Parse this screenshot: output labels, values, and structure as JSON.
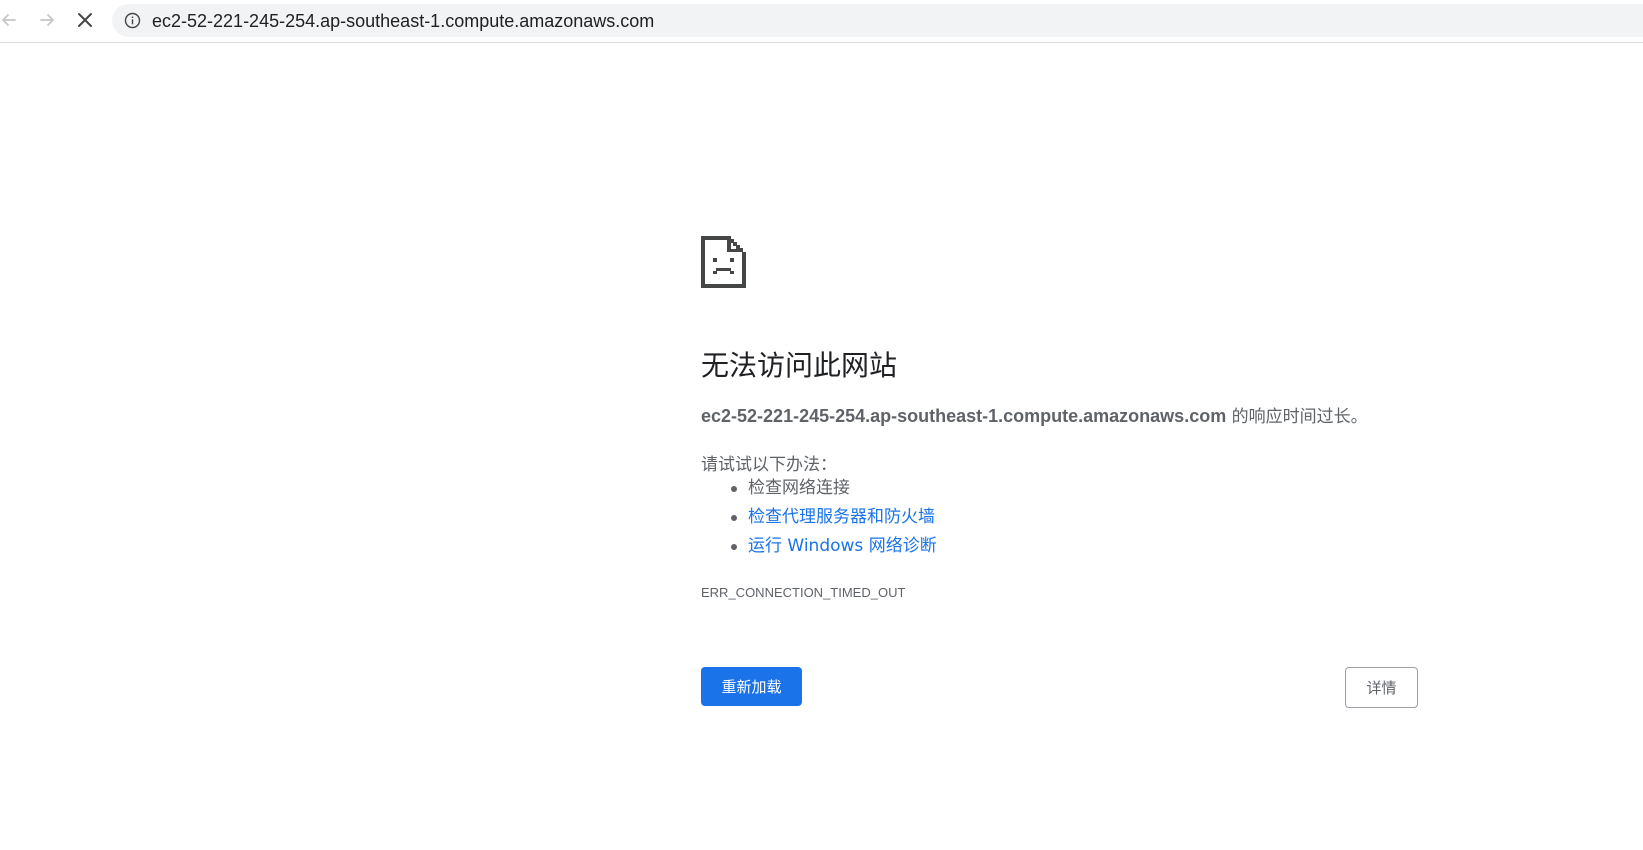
{
  "browser": {
    "back_icon": "arrow-left-icon",
    "forward_icon": "arrow-right-icon",
    "stop_icon": "close-icon",
    "site_info_icon": "info-icon",
    "url": "ec2-52-221-245-254.ap-southeast-1.compute.amazonaws.com"
  },
  "error_page": {
    "icon": "sad-page-icon",
    "heading": "无法访问此网站",
    "host": "ec2-52-221-245-254.ap-southeast-1.compute.amazonaws.com",
    "summary_suffix": " 的响应时间过长。",
    "try_label": "请试试以下办法：",
    "suggestions": [
      {
        "label": "检查网络连接",
        "is_link": false
      },
      {
        "label": "检查代理服务器和防火墙",
        "is_link": true
      },
      {
        "label": "运行 Windows 网络诊断",
        "is_link": true
      }
    ],
    "error_code": "ERR_CONNECTION_TIMED_OUT",
    "reload_label": "重新加载",
    "details_label": "详情"
  },
  "colors": {
    "accent": "#1a73e8",
    "text_primary": "#202124",
    "text_secondary": "#5f6368",
    "omnibox_bg": "#f1f3f4"
  }
}
